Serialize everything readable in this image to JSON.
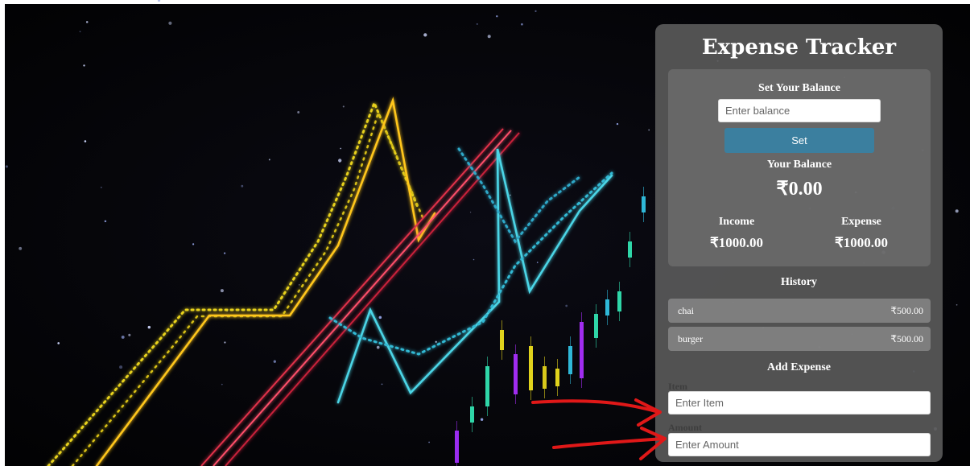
{
  "app": {
    "title": "Expense Tracker"
  },
  "set_balance": {
    "heading": "Set Your Balance",
    "input_placeholder": "Enter balance",
    "input_value": "",
    "button_label": "Set"
  },
  "balance": {
    "heading": "Your Balance",
    "amount": "₹0.00"
  },
  "income": {
    "label": "Income",
    "amount": "₹1000.00"
  },
  "expense": {
    "label": "Expense",
    "amount": "₹1000.00"
  },
  "history": {
    "heading": "History",
    "items": [
      {
        "name": "chai",
        "amount": "₹500.00"
      },
      {
        "name": "burger",
        "amount": "₹500.00"
      }
    ]
  },
  "add_expense": {
    "heading": "Add Expense",
    "item_label": "Item",
    "item_placeholder": "Enter Item",
    "amount_label": "Amount",
    "amount_placeholder": "Enter Amount"
  },
  "colors": {
    "panel_bg": "#585858",
    "button_bg": "#3b7f9f",
    "annotation_arrow": "#e01818"
  }
}
